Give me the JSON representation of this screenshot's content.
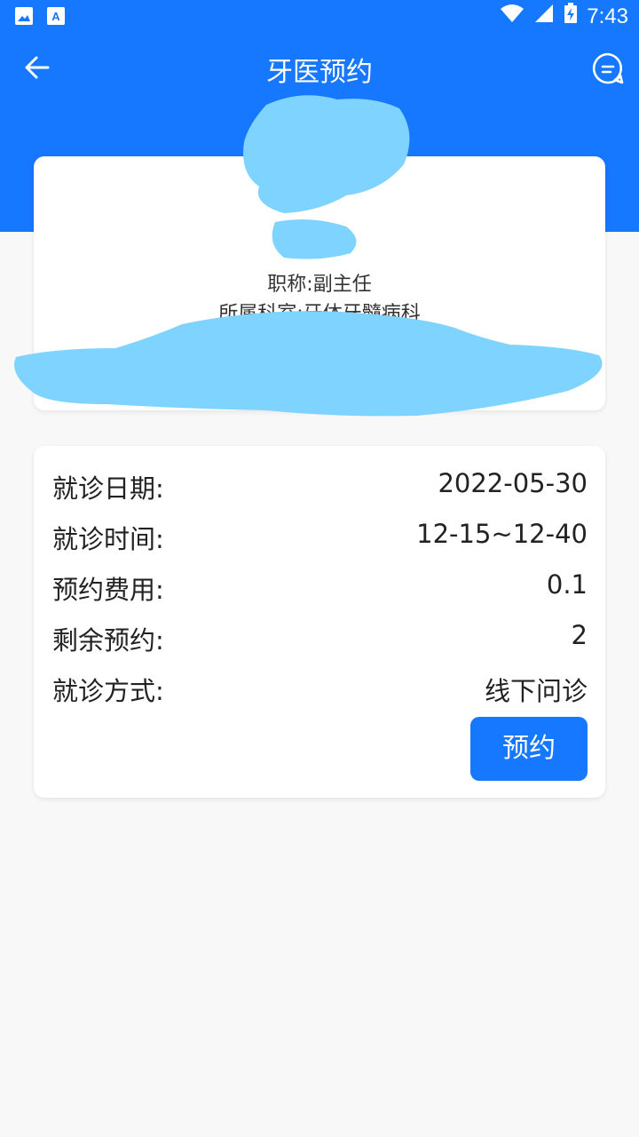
{
  "status_bar": {
    "time": "7:43",
    "icons": [
      "image-icon",
      "app-a-icon",
      "wifi-icon",
      "signal-icon",
      "battery-charging-icon"
    ]
  },
  "nav": {
    "title": "牙医预约",
    "back_icon": "arrow-left-icon",
    "action_icon": "chat-bubble-icon"
  },
  "doctor": {
    "title_line": "职称:副主任",
    "department_line": "所属科室:牙体牙髓病科"
  },
  "appointment": {
    "rows": [
      {
        "label": "就诊日期:",
        "value": "2022-05-30"
      },
      {
        "label": "就诊时间:",
        "value": "12-15~12-40"
      },
      {
        "label": "预约费用:",
        "value": "0.1"
      },
      {
        "label": "剩余预约:",
        "value": "2"
      },
      {
        "label": "就诊方式:",
        "value": "线下问诊"
      }
    ],
    "book_button": "预约"
  },
  "colors": {
    "primary": "#1677ff",
    "redaction": "#7fd3ff",
    "background": "#f8f8f8"
  }
}
